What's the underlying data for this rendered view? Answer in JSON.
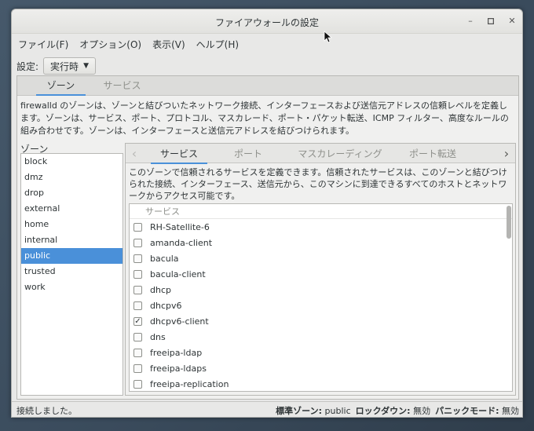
{
  "window": {
    "title": "ファイアウォールの設定"
  },
  "menu": [
    "ファイル(F)",
    "オプション(O)",
    "表示(V)",
    "ヘルプ(H)"
  ],
  "config": {
    "label": "設定:",
    "value": "実行時"
  },
  "top_tabs": [
    "ゾーン",
    "サービス"
  ],
  "zones_description": "firewalld のゾーンは、ゾーンと結びついたネットワーク接続、インターフェースおよび送信元アドレスの信頼レベルを定義します。ゾーンは、サービス、ポート、プロトコル、マスカレード、ポート・パケット転送、ICMP フィルター、高度なルールの組み合わせです。ゾーンは、インターフェースと送信元アドレスを結びつけられます。",
  "zones_label": "ゾーン",
  "zones": [
    "block",
    "dmz",
    "drop",
    "external",
    "home",
    "internal",
    "public",
    "trusted",
    "work"
  ],
  "selected_zone": "public",
  "sub_tabs": [
    "サービス",
    "ポート",
    "マスカレーディング",
    "ポート転送"
  ],
  "services_description": "このゾーンで信頼されるサービスを定義できます。信頼されたサービスは、このゾーンと結びつけられた接続、インターフェース、送信元から、このマシンに到達できるすべてのホストとネットワークからアクセス可能です。",
  "services_header": "サービス",
  "services": [
    {
      "name": "RH-Satellite-6",
      "checked": false
    },
    {
      "name": "amanda-client",
      "checked": false
    },
    {
      "name": "bacula",
      "checked": false
    },
    {
      "name": "bacula-client",
      "checked": false
    },
    {
      "name": "dhcp",
      "checked": false
    },
    {
      "name": "dhcpv6",
      "checked": false
    },
    {
      "name": "dhcpv6-client",
      "checked": true
    },
    {
      "name": "dns",
      "checked": false
    },
    {
      "name": "freeipa-ldap",
      "checked": false
    },
    {
      "name": "freeipa-ldaps",
      "checked": false
    },
    {
      "name": "freeipa-replication",
      "checked": false
    }
  ],
  "status": {
    "message": "接続しました。",
    "default_zone_label": "標準ゾーン:",
    "default_zone": "public",
    "lockdown_label": "ロックダウン:",
    "lockdown": "無効",
    "panic_label": "パニックモード:",
    "panic": "無効"
  },
  "colors": {
    "accent": "#4a90d9",
    "window_bg": "#e8e8e7"
  }
}
